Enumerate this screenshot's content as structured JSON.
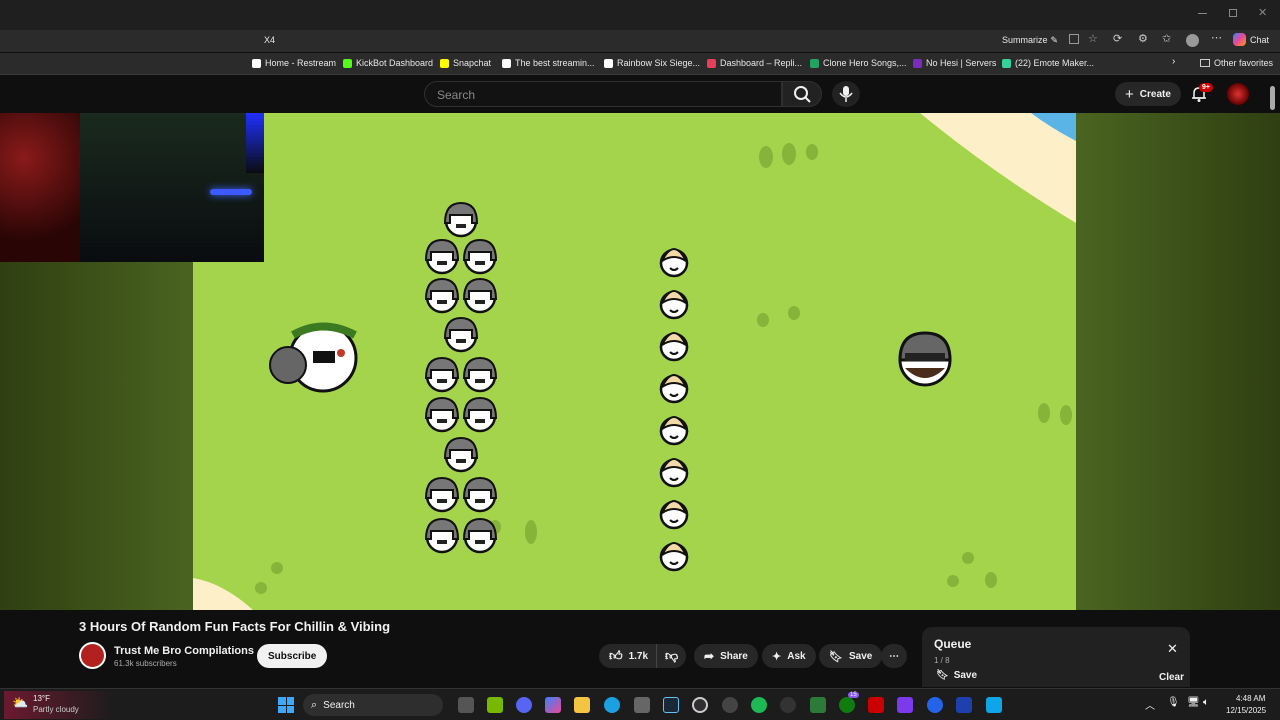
{
  "browser": {
    "address_fragment": "X4",
    "summarize_label": "Summarize",
    "chat_label": "Chat",
    "bookmarks": [
      {
        "label": "Home - Restream",
        "color": "#ffffff"
      },
      {
        "label": "KickBot Dashboard",
        "color": "#53fc18"
      },
      {
        "label": "Snapchat",
        "color": "#fffc00"
      },
      {
        "label": "The best streamin...",
        "color": "#ffffff"
      },
      {
        "label": "Rainbow Six Siege...",
        "color": "#ffffff"
      },
      {
        "label": "Dashboard – Repli...",
        "color": "#e83e5c"
      },
      {
        "label": "Clone Hero Songs,...",
        "color": "#1fa463"
      },
      {
        "label": "No Hesi | Servers",
        "color": "#7b2cbf"
      },
      {
        "label": "(22) Emote Maker...",
        "color": "#34d399"
      }
    ],
    "other_favorites": "Other favorites"
  },
  "youtube": {
    "search_placeholder": "Search",
    "create_label": "Create",
    "notification_badge": "9+",
    "accent_color": "#ff0000"
  },
  "video": {
    "title": "3 Hours Of Random Fun Facts For Chillin & Vibing",
    "channel": "Trust Me Bro Compilations",
    "subscribers": "61.3k subscribers",
    "subscribe_label": "Subscribe",
    "likes": "1.7k",
    "share_label": "Share",
    "ask_label": "Ask",
    "save_label": "Save"
  },
  "queue": {
    "title": "Queue",
    "position": "1 / 8",
    "save_label": "Save",
    "clear_label": "Clear"
  },
  "taskbar": {
    "weather_temp": "13°F",
    "weather_desc": "Partly cloudy",
    "search_label": "Search",
    "time": "4:48 AM",
    "date": "12/15/2025",
    "steam_badge": "15"
  }
}
